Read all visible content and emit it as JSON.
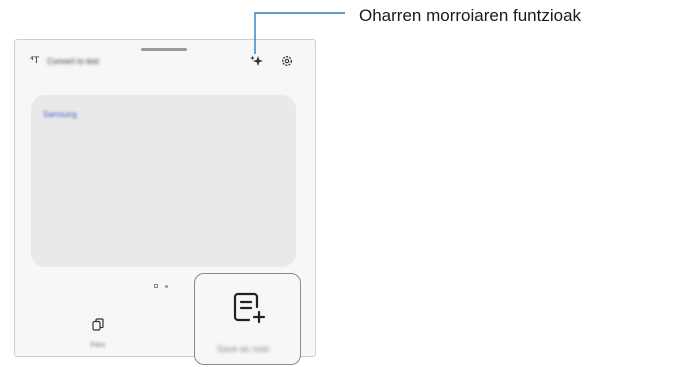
{
  "toolbar": {
    "title": "Convert to text",
    "left_icon": "text-convert-icon",
    "ai_icon": "ai-sparkle-icon",
    "settings_icon": "gear-icon"
  },
  "note_card": {
    "text": "Samsung"
  },
  "bottom_bar": {
    "files_label": "Files",
    "files_icon": "copy-files-icon",
    "save_label": "Save as note",
    "save_icon": "note-add-icon"
  },
  "callout": {
    "label": "Oharren morroiaren funtzioak",
    "color": "#2f7fb8"
  }
}
